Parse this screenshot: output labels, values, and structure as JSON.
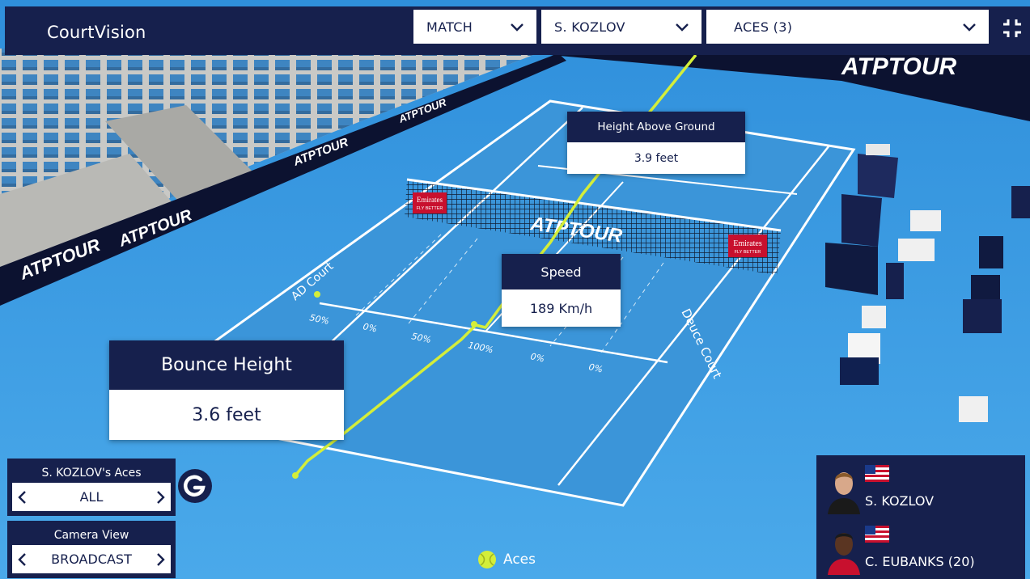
{
  "app": {
    "title": "CourtVision"
  },
  "filters": {
    "match": "MATCH",
    "player": "S. KOZLOV",
    "stat": "ACES (3)"
  },
  "court": {
    "side_left": "AD Court",
    "side_right": "Deuce Court",
    "sponsor_tour": "ATPTOUR",
    "net_sponsor": "Emirates",
    "net_sponsor_sub": "FLY BETTER",
    "service_box_pct": [
      "50%",
      "0%",
      "50%",
      "100%",
      "0%",
      "0%"
    ]
  },
  "tooltips": {
    "height": {
      "label": "Height Above Ground",
      "value": "3.9 feet"
    },
    "speed": {
      "label": "Speed",
      "value": "189 Km/h"
    },
    "bounce": {
      "label": "Bounce Height",
      "value": "3.6 feet"
    }
  },
  "controls": {
    "aces": {
      "label": "S. KOZLOV's Aces",
      "value": "ALL"
    },
    "camera": {
      "label": "Camera View",
      "value": "BROADCAST"
    },
    "badge": "G"
  },
  "legend": {
    "label": "Aces"
  },
  "players": [
    {
      "name": "S. KOZLOV",
      "flag": "us-flag-icon"
    },
    {
      "name": "C. EUBANKS (20)",
      "flag": "us-flag-icon"
    }
  ],
  "colors": {
    "navy": "#16204d",
    "court_blue": "#3d9de0",
    "ball_track": "#d4ee3a",
    "white": "#ffffff"
  }
}
